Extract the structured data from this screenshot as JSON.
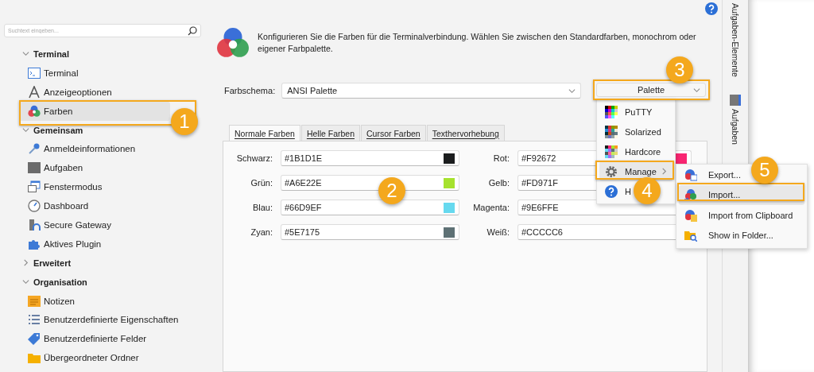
{
  "search": {
    "placeholder": "Suchtext eingeben..."
  },
  "sidebar": {
    "sections": [
      {
        "label": "Terminal",
        "expanded": true,
        "children": [
          {
            "label": "Terminal",
            "selected": false
          },
          {
            "label": "Anzeigeoptionen",
            "selected": false
          },
          {
            "label": "Farben",
            "selected": true
          }
        ]
      },
      {
        "label": "Gemeinsam",
        "expanded": true,
        "children": [
          {
            "label": "Anmeldeinformationen",
            "selected": false
          },
          {
            "label": "Aufgaben",
            "selected": false
          },
          {
            "label": "Fenstermodus",
            "selected": false
          },
          {
            "label": "Dashboard",
            "selected": false
          },
          {
            "label": "Secure Gateway",
            "selected": false
          },
          {
            "label": "Aktives Plugin",
            "selected": false
          }
        ]
      },
      {
        "label": "Erweitert",
        "expanded": false
      },
      {
        "label": "Organisation",
        "expanded": true,
        "children": [
          {
            "label": "Notizen",
            "selected": false
          },
          {
            "label": "Benutzerdefinierte Eigenschaften",
            "selected": false
          },
          {
            "label": "Benutzerdefinierte Felder",
            "selected": false
          },
          {
            "label": "Übergeordneter Ordner",
            "selected": false
          }
        ]
      }
    ]
  },
  "description": "Konfigurieren Sie die Farben für die Terminalverbindung. Wählen Sie zwischen den Standardfarben, monochrom oder eigener Farbpalette.",
  "color_scheme": {
    "label": "Farbschema:",
    "value": "ANSI Palette"
  },
  "palette_button": {
    "label": "Palette"
  },
  "tabs": [
    {
      "label": "Normale Farben",
      "selected": true
    },
    {
      "label": "Helle Farben",
      "selected": false
    },
    {
      "label": "Cursor Farben",
      "selected": false
    },
    {
      "label": "Texthervorhebung",
      "selected": false
    }
  ],
  "colors": [
    {
      "label": "Schwarz:",
      "value": "#1B1D1E",
      "color": "#1b1d1e"
    },
    {
      "label": "Rot:",
      "value": "#F92672",
      "color": "#f92672"
    },
    {
      "label": "Grün:",
      "value": "#A6E22E",
      "color": "#a6e22e"
    },
    {
      "label": "Gelb:",
      "value": "#FD971F"
    },
    {
      "label": "Blau:",
      "value": "#66D9EF",
      "color": "#66d9ef"
    },
    {
      "label": "Magenta:",
      "value": "#9E6FFE"
    },
    {
      "label": "Zyan:",
      "value": "#5E7175",
      "color": "#5e7175"
    },
    {
      "label": "Weiß:",
      "value": "#CCCCC6"
    }
  ],
  "palette_menu": [
    {
      "label": "PuTTY",
      "kind": "item",
      "selected": false
    },
    {
      "label": "Solarized",
      "kind": "item",
      "selected": false
    },
    {
      "label": "Hardcore",
      "kind": "item",
      "selected": false
    },
    {
      "label": "Manage",
      "kind": "submenu",
      "selected": true
    },
    {
      "label": "H",
      "kind": "help",
      "selected": false
    }
  ],
  "manage_menu": [
    {
      "label": "Export...",
      "selected": false
    },
    {
      "label": "Import...",
      "selected": true
    },
    {
      "label": "Import from Clipboard",
      "selected": false
    },
    {
      "label": "Show in Folder...",
      "selected": false
    }
  ],
  "side_strip": [
    "Aufgaben-Elemente",
    "Aufgaben"
  ],
  "callouts": [
    "1",
    "2",
    "3",
    "4",
    "5"
  ]
}
